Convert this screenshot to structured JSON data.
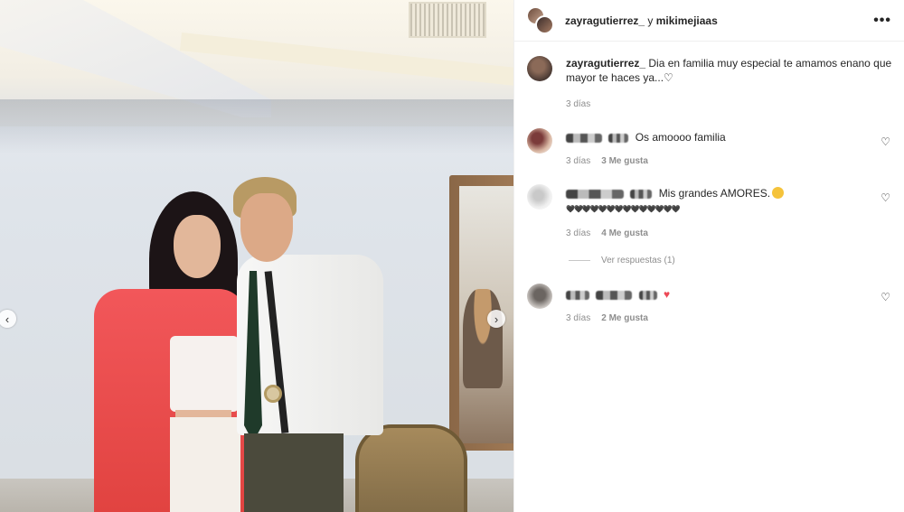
{
  "header": {
    "user1": "zayragutierrez_",
    "separator": "y",
    "user2": "mikimejiaas"
  },
  "post": {
    "caption_user": "zayragutierrez_",
    "caption_text": "Dia en familia muy especial te amamos enano que mayor te haces ya...",
    "time": "3 días"
  },
  "comments": [
    {
      "text": "Os amoooo familia",
      "time": "3 días",
      "likes": "3 Me gusta"
    },
    {
      "text": "Mis grandes AMORES.",
      "text2": "🖤🖤🖤🖤🖤🖤🖤🖤🖤🖤🖤🖤🖤🖤",
      "time": "3 días",
      "likes": "4 Me gusta",
      "replies": "Ver respuestas (1)"
    },
    {
      "text": "",
      "time": "3 días",
      "likes": "2 Me gusta"
    }
  ],
  "icons": {
    "more": "more-icon",
    "like": "heart-icon",
    "nav_prev": "chevron-left-icon",
    "nav_next": "chevron-right-icon"
  },
  "colors": {
    "text": "#262626",
    "meta": "#8e8e8e",
    "heart_red": "#ed4956"
  }
}
